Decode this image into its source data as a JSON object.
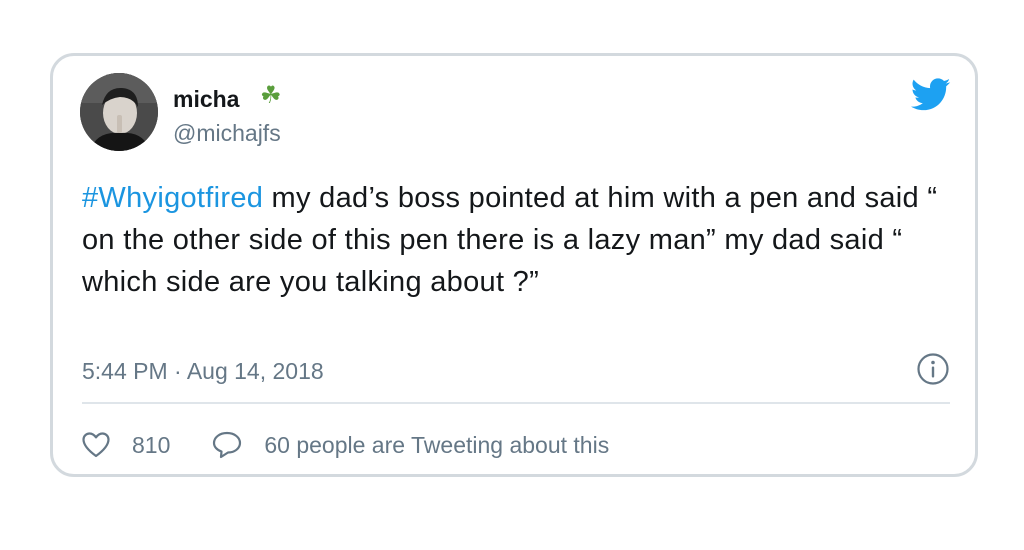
{
  "tweet": {
    "author": {
      "display_name": "micha",
      "emoji": "☘",
      "handle": "@michajfs"
    },
    "hashtag": "#Whyigotfired",
    "body": " my dad’s boss pointed at him with a pen and said “ on the other side of this pen there is a lazy man” my dad said “ which side are you talking about ?”",
    "timestamp": "5:44 PM · Aug 14, 2018",
    "likes": "810",
    "tweeting_about": "60 people are Tweeting about this"
  },
  "icons": [
    "avatar-photo",
    "twitter-bird-icon",
    "info-icon",
    "heart-icon",
    "speech-bubble-icon"
  ],
  "colors": {
    "hashtag": "#1b95e0",
    "bird": "#1da1f2",
    "secondary_text": "#657786",
    "border": "#d3d9de"
  }
}
